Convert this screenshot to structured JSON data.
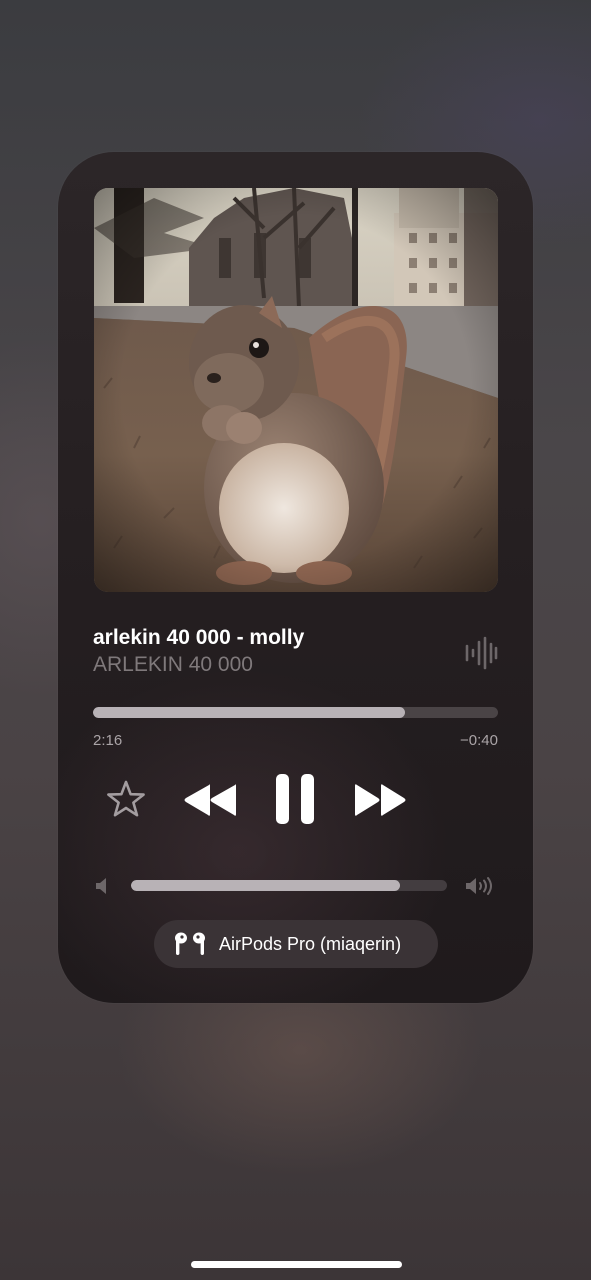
{
  "now_playing": {
    "title": "arlekin 40 000 - molly",
    "artist": "ARLEKIN 40 000",
    "artwork_icon": "album-artwork-squirrel"
  },
  "playback": {
    "elapsed": "2:16",
    "remaining": "−0:40",
    "progress_fraction": 0.77,
    "state": "playing"
  },
  "controls": {
    "favorite_icon": "star-icon",
    "previous_icon": "rewind-icon",
    "play_pause_icon": "pause-icon",
    "next_icon": "fast-forward-icon"
  },
  "volume": {
    "level_fraction": 0.85,
    "low_icon": "speaker-low-icon",
    "high_icon": "speaker-high-icon"
  },
  "output_device": {
    "label": "AirPods Pro (miaqerin)",
    "icon": "airpods-icon"
  },
  "colors": {
    "accent_fill": "#b8b2b6",
    "track_bg": "#4a4446",
    "secondary_text": "#7f797b"
  }
}
